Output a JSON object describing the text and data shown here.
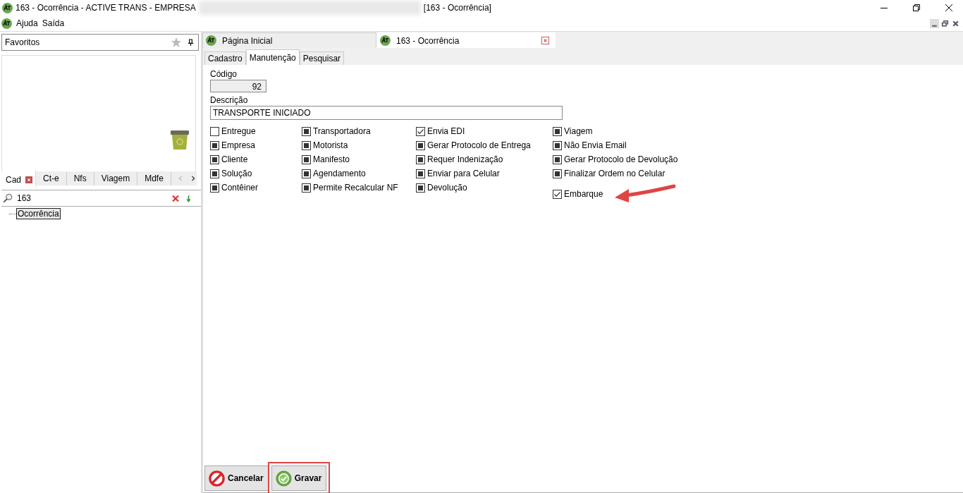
{
  "window": {
    "title": "163 - Ocorrência - ACTIVE TRANS - EMPRESA",
    "title_suffix": "[163 - Ocorrência]"
  },
  "menu": [
    "Ajuda",
    "Saída"
  ],
  "sidebar": {
    "favorites": {
      "label": "Favoritos"
    },
    "tabs": [
      {
        "label": "Cad",
        "selected": true,
        "closable": true
      },
      {
        "label": "Ct-e",
        "selected": false,
        "closable": false
      },
      {
        "label": "Nfs",
        "selected": false,
        "closable": false
      },
      {
        "label": "Viagem",
        "selected": false,
        "closable": false
      },
      {
        "label": "Mdfe",
        "selected": false,
        "closable": false
      }
    ],
    "search": {
      "value": "163"
    },
    "tree": [
      {
        "label": "Ocorrência",
        "selected": true
      }
    ]
  },
  "doc_tabs": [
    {
      "label": "Página Inicial",
      "selected": false,
      "closable": false
    },
    {
      "label": "163 - Ocorrência",
      "selected": true,
      "closable": true
    }
  ],
  "sub_tabs": [
    {
      "label": "Cadastro",
      "selected": false
    },
    {
      "label": "Manutenção",
      "selected": true
    },
    {
      "label": "Pesquisar",
      "selected": false
    }
  ],
  "form": {
    "code": {
      "label": "Código",
      "value": "92"
    },
    "description": {
      "label": "Descrição",
      "value": "TRANSPORTE INICIADO"
    },
    "checkbox_columns": [
      [
        {
          "label": "Entregue",
          "checked": false,
          "indeterminate": false
        },
        {
          "label": "Empresa",
          "checked": false,
          "indeterminate": true
        },
        {
          "label": "Cliente",
          "checked": false,
          "indeterminate": true
        },
        {
          "label": "Solução",
          "checked": false,
          "indeterminate": true
        },
        {
          "label": "Contêiner",
          "checked": false,
          "indeterminate": true
        }
      ],
      [
        {
          "label": "Transportadora",
          "checked": false,
          "indeterminate": true
        },
        {
          "label": "Motorista",
          "checked": false,
          "indeterminate": true
        },
        {
          "label": "Manifesto",
          "checked": false,
          "indeterminate": true
        },
        {
          "label": "Agendamento",
          "checked": false,
          "indeterminate": true
        },
        {
          "label": "Permite Recalcular NF",
          "checked": false,
          "indeterminate": true
        }
      ],
      [
        {
          "label": "Envia EDI",
          "checked": true,
          "indeterminate": false
        },
        {
          "label": "Gerar Protocolo de Entrega",
          "checked": false,
          "indeterminate": true
        },
        {
          "label": "Requer Indenização",
          "checked": false,
          "indeterminate": true
        },
        {
          "label": "Enviar para Celular",
          "checked": false,
          "indeterminate": true
        },
        {
          "label": "Devolução",
          "checked": false,
          "indeterminate": true
        }
      ],
      [
        {
          "label": "Viagem",
          "checked": false,
          "indeterminate": true
        },
        {
          "label": "Não Envia Email",
          "checked": false,
          "indeterminate": true
        },
        {
          "label": "Gerar Protocolo de Devolução",
          "checked": false,
          "indeterminate": true
        },
        {
          "label": "Finalizar Ordem no Celular",
          "checked": false,
          "indeterminate": true
        },
        {
          "label": "Embarque",
          "checked": true,
          "indeterminate": false
        }
      ]
    ]
  },
  "buttons": [
    {
      "label": "Cancelar",
      "kind": "cancel",
      "highlighted": false
    },
    {
      "label": "Gravar",
      "kind": "save",
      "highlighted": true
    }
  ]
}
